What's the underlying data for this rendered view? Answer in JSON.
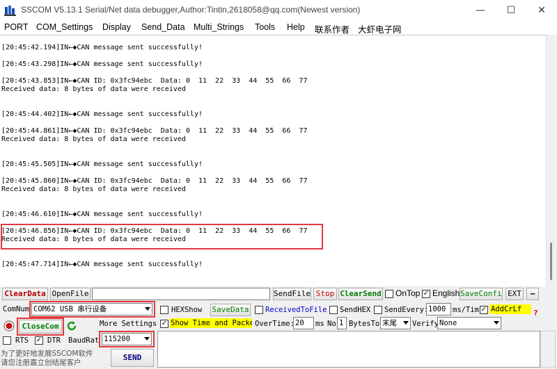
{
  "window": {
    "title": "SSCOM V5.13.1 Serial/Net data debugger,Author:Tintin,2618058@qq.com(Newest version)",
    "minimize": "—",
    "maximize": "☐",
    "close": "✕"
  },
  "menu": [
    "PORT",
    "COM_Settings",
    "Display",
    "Send_Data",
    "Multi_Strings",
    "Tools",
    "Help",
    "联系作者",
    "大虾电子网"
  ],
  "output_lines": [
    "[20:45:42.194]IN←◆CAN message sent successfully!",
    "",
    "[20:45:43.298]IN←◆CAN message sent successfully!",
    "",
    "[20:45:43.853]IN←◆CAN ID: 0x3fc94ebc  Data: 0  11  22  33  44  55  66  77",
    "Received data: 8 bytes of data were received",
    "",
    "",
    "[20:45:44.402]IN←◆CAN message sent successfully!",
    "",
    "[20:45:44.861]IN←◆CAN ID: 0x3fc94ebc  Data: 0  11  22  33  44  55  66  77",
    "Received data: 8 bytes of data were received",
    "",
    "",
    "[20:45:45.505]IN←◆CAN message sent successfully!",
    "",
    "[20:45:45.860]IN←◆CAN ID: 0x3fc94ebc  Data: 0  11  22  33  44  55  66  77",
    "Received data: 8 bytes of data were received",
    "",
    "",
    "[20:45:46.610]IN←◆CAN message sent successfully!",
    "",
    "[20:45:46.856]IN←◆CAN ID: 0x3fc94ebc  Data: 0  11  22  33  44  55  66  77",
    "Received data: 8 bytes of data were received",
    "",
    "",
    "[20:45:47.714]IN←◆CAN message sent successfully!"
  ],
  "toolbar": {
    "clear_data": "ClearData",
    "open_file": "OpenFile",
    "send_file": "SendFile",
    "stop": "Stop",
    "clear_send": "ClearSend",
    "ontop": "OnTop",
    "english": "English",
    "save_config": "SaveConfig",
    "ext": "EXT",
    "dash": "—"
  },
  "port": {
    "comnum_label": "ComNum",
    "comnum_value": "COM62 USB 串行设备",
    "close_com": "CloseCom",
    "more_settings": "More Settings",
    "rts": "RTS",
    "dtr": "DTR",
    "baud_label": "BaudRat",
    "baud_value": "115200",
    "promo_line1": "为了更好地发展SSCOM软件",
    "promo_line2": "请您注册嘉立创结尾客户",
    "send": "SEND"
  },
  "options": {
    "hex_show": "HEXShow",
    "save_data": "SaveData",
    "received_to_file": "ReceivedToFile",
    "send_hex": "SendHEX",
    "send_every": "SendEvery:",
    "send_every_value": "1000",
    "ms_tim": "ms/Tim",
    "add_crlf": "AddCrLf",
    "question": "?",
    "show_time": "Show Time and Packe",
    "overtime": "OverTime:",
    "overtime_value": "20",
    "ms": "ms",
    "no": "No",
    "no_value": "1",
    "bytes_to": "BytesTo",
    "bytes_to_value": "末尾",
    "verify": "Verify",
    "verify_value": "None"
  },
  "colors": {
    "accent_red": "#e2393f",
    "link_green": "#008000",
    "link_blue": "#0000cc",
    "dark_red": "#b00000",
    "yellow": "#ffff00"
  }
}
